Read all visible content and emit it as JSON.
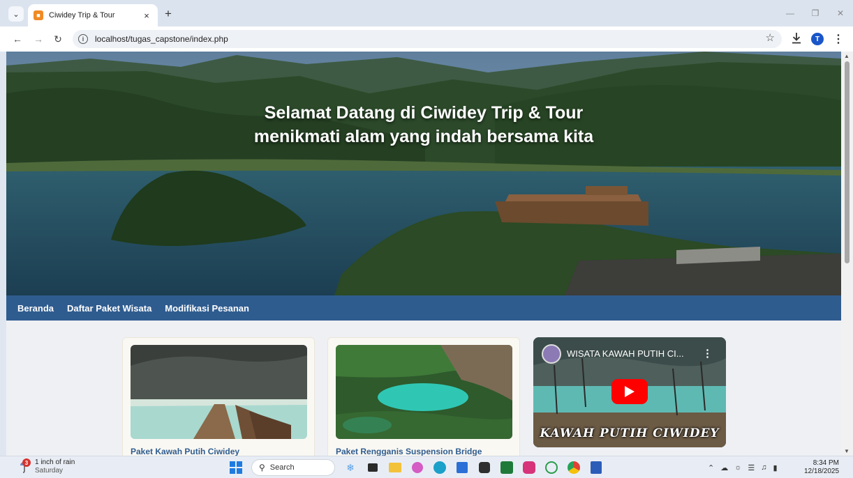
{
  "browser": {
    "tab_title": "Ciwidey Trip & Tour",
    "tab_close": "×",
    "new_tab": "+",
    "url": "localhost/tugas_capstone/index.php",
    "profile_initial": "T"
  },
  "hero": {
    "title_line1": "Selamat Datang di Ciwidey Trip & Tour",
    "title_line2": "menikmati alam yang indah bersama kita"
  },
  "nav": {
    "items": [
      {
        "label": "Beranda"
      },
      {
        "label": "Daftar Paket Wisata"
      },
      {
        "label": "Modifikasi Pesanan"
      }
    ]
  },
  "cards": [
    {
      "title": "Paket Kawah Putih Ciwidey"
    },
    {
      "title": "Paket Rengganis Suspension Bridge"
    }
  ],
  "video": {
    "title": "WISATA KAWAH PUTIH CI...",
    "caption": "KAWAH PUTIH CIWIDEY"
  },
  "taskbar": {
    "weather_badge": "3",
    "weather_line1": "1 inch of rain",
    "weather_line2": "Saturday",
    "search_label": "Search",
    "time": "8:34 PM",
    "date": "12/18/2025"
  },
  "colors": {
    "navbar": "#2f5c8f",
    "tabstrip": "#dbe3ee",
    "youtube_red": "#ff0000"
  },
  "icons": [
    "tab-list-icon",
    "back-arrow-icon",
    "forward-arrow-icon",
    "reload-icon",
    "info-icon",
    "star-icon",
    "download-icon",
    "more-menu-icon",
    "windows-start-icon",
    "search-icon",
    "play-icon"
  ]
}
